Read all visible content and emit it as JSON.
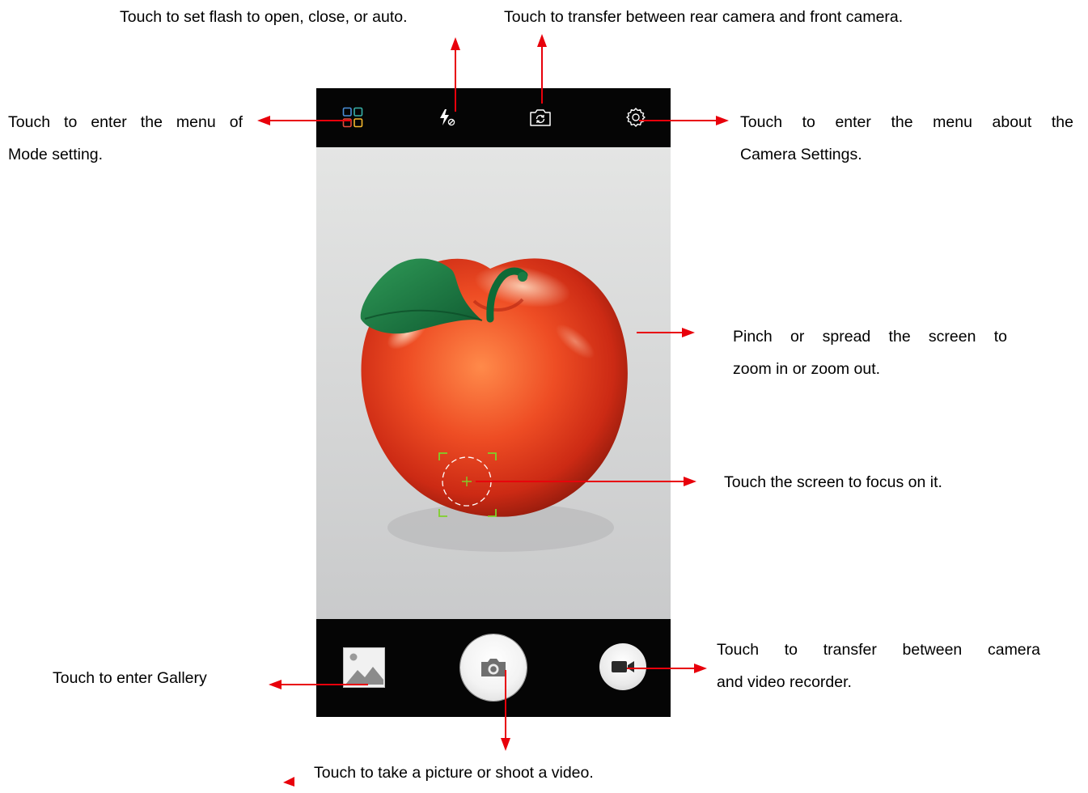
{
  "annotations": {
    "flash": "Touch to set flash to open, close, or auto.",
    "switch_camera": "Touch to transfer between rear camera and front camera.",
    "mode_menu": [
      "Touch to enter the menu of",
      "Mode setting."
    ],
    "camera_settings": [
      "Touch to enter the menu about the",
      "Camera Settings."
    ],
    "zoom": [
      "Pinch or spread the screen to",
      "zoom in or zoom out."
    ],
    "focus": "Touch the screen to focus on it.",
    "gallery": "Touch to enter Gallery",
    "camera_video_toggle": [
      "Touch to transfer between camera",
      "and video recorder."
    ],
    "shutter": "Touch to take a picture or shoot a video."
  },
  "camera_ui": {
    "top_bar_icons": [
      "mode-grid-icon",
      "flash-off-icon",
      "switch-camera-icon",
      "gear-icon"
    ],
    "bottom_bar_icons": [
      "gallery-thumbnail-icon",
      "camera-icon",
      "video-camera-icon"
    ],
    "viewfinder_subject": "apple",
    "focus_indicator": "focus-reticle-icon"
  },
  "colors": {
    "annotation_arrow": "#e8000b",
    "bar_background": "#050505",
    "focus_reticle": "#7fd02a",
    "mode_grid": [
      "#4a90d9",
      "#38b2a8",
      "#e64a3b",
      "#f5b82e"
    ]
  }
}
